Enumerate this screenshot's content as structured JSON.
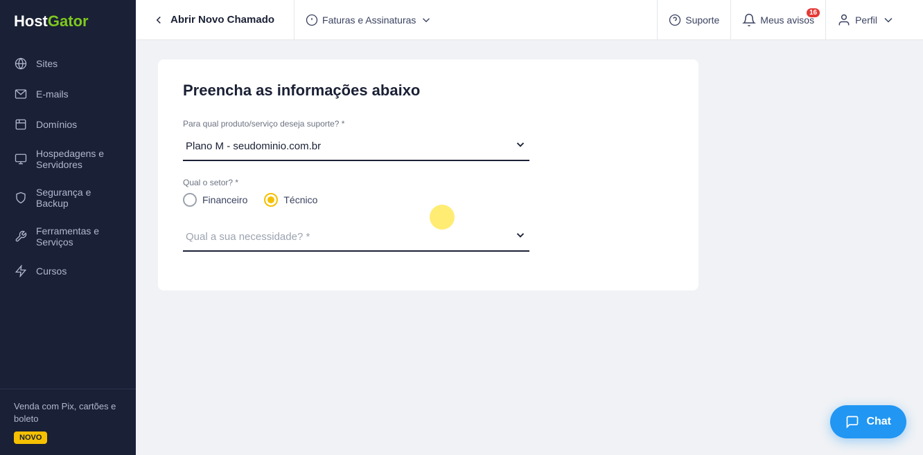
{
  "sidebar": {
    "logo": "HostGator",
    "items": [
      {
        "id": "sites",
        "label": "Sites"
      },
      {
        "id": "emails",
        "label": "E-mails"
      },
      {
        "id": "dominios",
        "label": "Domínios"
      },
      {
        "id": "hospedagens",
        "label": "Hospedagens e Servidores"
      },
      {
        "id": "seguranca",
        "label": "Segurança e Backup"
      },
      {
        "id": "ferramentas",
        "label": "Ferramentas e Serviços"
      },
      {
        "id": "cursos",
        "label": "Cursos"
      }
    ],
    "promo": {
      "text": "Venda com Pix, cartões e boleto",
      "badge": "NOVO"
    }
  },
  "topnav": {
    "back_label": "Abrir Novo Chamado",
    "faturas_label": "Faturas e Assinaturas",
    "suporte_label": "Suporte",
    "avisos_label": "Meus avisos",
    "perfil_label": "Perfil",
    "badge_count": "16"
  },
  "form": {
    "title": "Preencha as informações abaixo",
    "product_label": "Para qual produto/serviço deseja suporte? *",
    "product_value": "Plano M - seudominio.com.br",
    "setor_label": "Qual o setor? *",
    "setor_options": [
      {
        "id": "financeiro",
        "label": "Financeiro",
        "selected": false
      },
      {
        "id": "tecnico",
        "label": "Técnico",
        "selected": true
      }
    ],
    "necessidade_label": "Qual a sua necessidade? *",
    "necessidade_placeholder": "Qual a sua necessidade? *"
  },
  "chat": {
    "label": "Chat"
  }
}
